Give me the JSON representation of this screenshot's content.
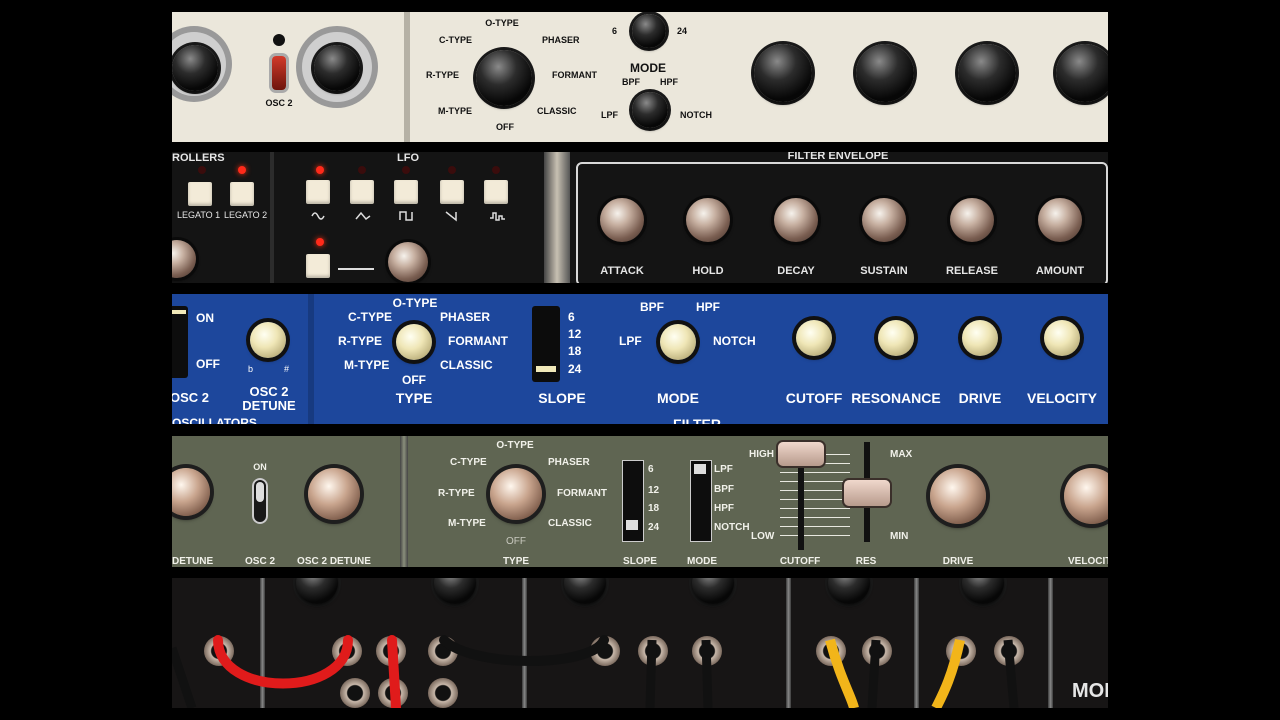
{
  "strip1": {
    "toggle_label": "OSC 2",
    "mode_title": "MODE",
    "type_selector": {
      "options": [
        "O-TYPE",
        "PHASER",
        "FORMANT",
        "CLASSIC",
        "OFF",
        "M-TYPE",
        "R-TYPE",
        "C-TYPE"
      ]
    },
    "slope_selector": {
      "options": [
        "6",
        "24"
      ]
    },
    "mode_selector": {
      "options": [
        "BPF",
        "HPF",
        "NOTCH",
        "LPF"
      ]
    }
  },
  "strip2": {
    "controllers_title": "ROLLERS",
    "legato1": "LEGATO 1",
    "legato2": "LEGATO 2",
    "lfo_title": "LFO",
    "filter_env_title": "FILTER ENVELOPE",
    "env_knobs": [
      "ATTACK",
      "HOLD",
      "DECAY",
      "SUSTAIN",
      "RELEASE",
      "AMOUNT"
    ]
  },
  "strip3": {
    "osc2_on": "ON",
    "osc2_off": "OFF",
    "osc2_label": "OSC 2",
    "detune_label_1": "OSC 2",
    "detune_label_2": "DETUNE",
    "detune_flat": "b",
    "detune_sharp": "#",
    "type_options": [
      "O-TYPE",
      "PHASER",
      "FORMANT",
      "CLASSIC",
      "OFF",
      "M-TYPE",
      "R-TYPE",
      "C-TYPE"
    ],
    "type_label": "TYPE",
    "slope_options": [
      "6",
      "12",
      "18",
      "24"
    ],
    "slope_label": "SLOPE",
    "mode_options": [
      "BPF",
      "HPF",
      "NOTCH",
      "LPF"
    ],
    "mode_label": "MODE",
    "knobs": [
      "CUTOFF",
      "RESONANCE",
      "DRIVE",
      "VELOCITY"
    ],
    "section_label": "FILTER",
    "osc_section_label": "OSCILLATORS"
  },
  "strip4": {
    "detune_label": "DETUNE",
    "osc2_on": "ON",
    "osc2_label": "OSC 2",
    "osc2_detune_label": "OSC 2 DETUNE",
    "type_options": [
      "O-TYPE",
      "PHASER",
      "FORMANT",
      "CLASSIC",
      "OFF",
      "M-TYPE",
      "R-TYPE",
      "C-TYPE"
    ],
    "type_label": "TYPE",
    "slope_options": [
      "6",
      "12",
      "18",
      "24"
    ],
    "slope_label": "SLOPE",
    "mode_options": [
      "LPF",
      "BPF",
      "HPF",
      "NOTCH"
    ],
    "mode_label": "MODE",
    "cutoff_high": "HIGH",
    "cutoff_low": "LOW",
    "cutoff_label": "CUTOFF",
    "res_max": "MAX",
    "res_min": "MIN",
    "res_label": "RES",
    "drive_label": "DRIVE",
    "velocity_label": "VELOCITY"
  },
  "strip5": {
    "brand_text": "MOD",
    "cable_colors": [
      "#e01b1b",
      "#1a1a1a",
      "#f2b51a"
    ]
  }
}
